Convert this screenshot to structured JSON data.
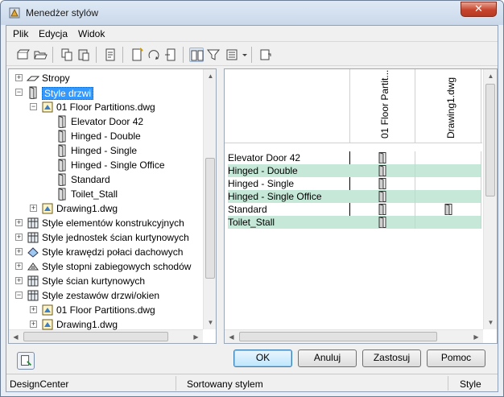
{
  "window": {
    "title": "Menedżer stylów",
    "close_label": "✕"
  },
  "menu": [
    {
      "label": "Plik",
      "key": "P"
    },
    {
      "label": "Edycja",
      "key": "E"
    },
    {
      "label": "Widok",
      "key": "W"
    }
  ],
  "tree": {
    "items": [
      {
        "label": "Stropy",
        "level": 1,
        "expander": "+",
        "icon": "slab-icon"
      },
      {
        "label": "Style drzwi",
        "level": 1,
        "expander": "−",
        "icon": "door-icon",
        "selected": true
      },
      {
        "label": "01 Floor Partitions.dwg",
        "level": 2,
        "expander": "−",
        "icon": "drawing-file-icon"
      },
      {
        "label": "Elevator Door 42",
        "level": 3,
        "icon": "door-style-icon"
      },
      {
        "label": "Hinged - Double",
        "level": 3,
        "icon": "door-style-icon"
      },
      {
        "label": "Hinged - Single",
        "level": 3,
        "icon": "door-style-icon"
      },
      {
        "label": "Hinged - Single Office",
        "level": 3,
        "icon": "door-style-icon"
      },
      {
        "label": "Standard",
        "level": 3,
        "icon": "door-style-icon"
      },
      {
        "label": "Toilet_Stall",
        "level": 3,
        "icon": "door-style-icon"
      },
      {
        "label": "Drawing1.dwg",
        "level": 2,
        "expander": "+",
        "icon": "drawing-file-icon"
      },
      {
        "label": "Style elementów konstrukcyjnych",
        "level": 1,
        "expander": "+",
        "icon": "structural-member-icon"
      },
      {
        "label": "Style jednostek ścian kurtynowych",
        "level": 1,
        "expander": "+",
        "icon": "curtain-wall-unit-icon"
      },
      {
        "label": "Style krawędzi połaci dachowych",
        "level": 1,
        "expander": "+",
        "icon": "roof-slab-edge-icon"
      },
      {
        "label": "Style stopni zabiegowych schodów",
        "level": 1,
        "expander": "+",
        "icon": "winder-stair-icon"
      },
      {
        "label": "Style ścian kurtynowych",
        "level": 1,
        "expander": "+",
        "icon": "curtain-wall-icon"
      },
      {
        "label": "Style zestawów drzwi/okien",
        "level": 1,
        "expander": "−",
        "icon": "door-window-assembly-icon"
      },
      {
        "label": "01 Floor Partitions.dwg",
        "level": 2,
        "expander": "+",
        "icon": "drawing-file-icon"
      },
      {
        "label": "Drawing1.dwg",
        "level": 2,
        "expander": "+",
        "icon": "drawing-file-icon"
      }
    ]
  },
  "grid": {
    "columns": [
      "01 Floor Partit...",
      "Drawing1.dwg"
    ],
    "rows": [
      {
        "label": "Elevator Door 42",
        "cells": [
          true,
          false
        ]
      },
      {
        "label": "Hinged - Double",
        "cells": [
          true,
          false
        ]
      },
      {
        "label": "Hinged - Single",
        "cells": [
          true,
          false
        ]
      },
      {
        "label": "Hinged - Single Office",
        "cells": [
          true,
          false
        ]
      },
      {
        "label": "Standard",
        "cells": [
          true,
          true
        ]
      },
      {
        "label": "Toilet_Stall",
        "cells": [
          true,
          false
        ]
      }
    ],
    "alt_row_color": "#c5e8d8"
  },
  "buttons": {
    "ok": "OK",
    "cancel": "Anuluj",
    "apply": "Zastosuj",
    "help": "Pomoc"
  },
  "status": {
    "left": "DesignCenter",
    "middle": "Sortowany stylem",
    "right": "Style"
  },
  "colors": {
    "selection": "#3399ff",
    "close": "#c6442d"
  }
}
